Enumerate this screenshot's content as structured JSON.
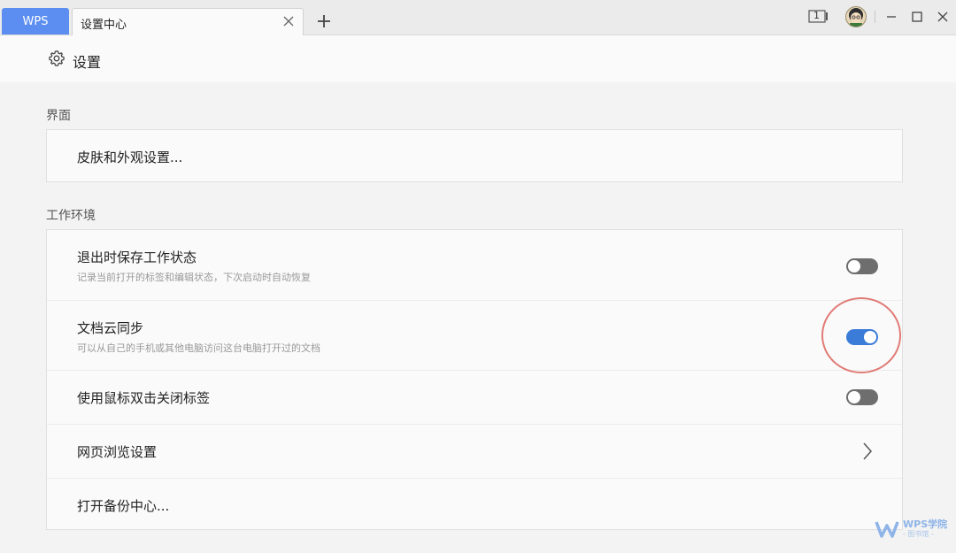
{
  "tabs": {
    "home_label": "WPS",
    "active_label": "设置中心"
  },
  "window": {
    "page_indicator": "1"
  },
  "header": {
    "title": "设置"
  },
  "sections": {
    "interface": {
      "label": "界面",
      "skin_label": "皮肤和外观设置..."
    },
    "workspace": {
      "label": "工作环境",
      "save_state": {
        "label": "退出时保存工作状态",
        "desc": "记录当前打开的标签和编辑状态，下次启动时自动恢复",
        "enabled": false
      },
      "cloud_sync": {
        "label": "文档云同步",
        "desc": "可以从自己的手机或其他电脑访问这台电脑打开过的文档",
        "enabled": true
      },
      "dblclick_close": {
        "label": "使用鼠标双击关闭标签",
        "enabled": false
      },
      "web_browse": {
        "label": "网页浏览设置"
      },
      "backup": {
        "label": "打开备份中心..."
      }
    }
  },
  "watermark": {
    "title": "WPS学院",
    "subtitle": "- 图书馆 -"
  },
  "colors": {
    "accent": "#3a7cd8",
    "wps_tab": "#5b8ef0",
    "highlight": "#e07b76"
  }
}
